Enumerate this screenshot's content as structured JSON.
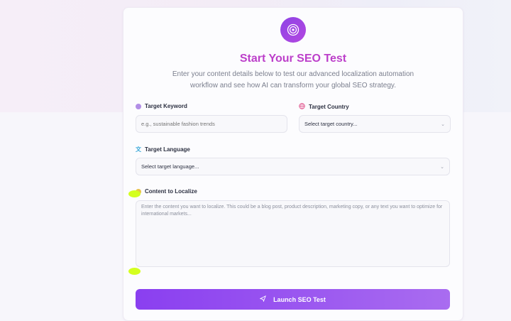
{
  "header": {
    "title": "Start Your SEO Test",
    "subtitle": "Enter your content details below to test our advanced localization automation workflow and see how AI can transform your global SEO strategy."
  },
  "form": {
    "keyword": {
      "label": "Target Keyword",
      "placeholder": "e.g., sustainable fashion trends"
    },
    "country": {
      "label": "Target Country",
      "selected": "Select target country..."
    },
    "language": {
      "label": "Target Language",
      "selected": "Select target language..."
    },
    "content": {
      "label": "Content to Localize",
      "placeholder": "Enter the content you want to localize. This could be a blog post, product description, marketing copy, or any text you want to optimize for international markets..."
    },
    "submit_label": "Launch SEO Test"
  },
  "colors": {
    "accent": "#8a3ff0",
    "title": "#bc3fca",
    "highlight": "#d4ff1f"
  },
  "icons": [
    "target-icon",
    "dot-icon",
    "globe-icon",
    "translate-icon",
    "send-icon"
  ]
}
